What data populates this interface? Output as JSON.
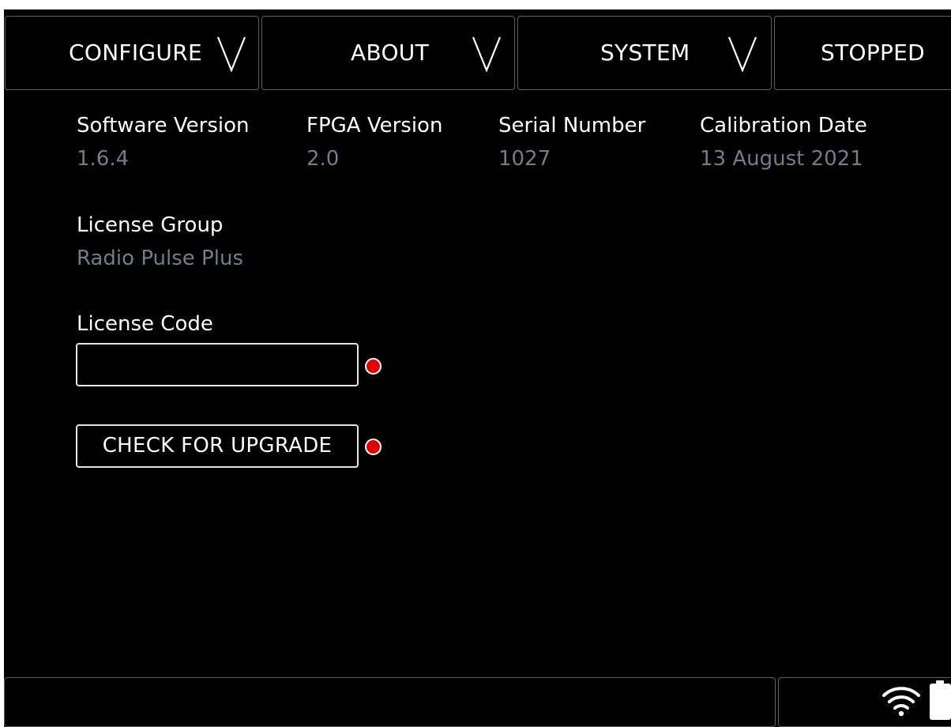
{
  "menu": {
    "tabs": [
      {
        "label": "CONFIGURE",
        "has_dropdown": true
      },
      {
        "label": "ABOUT",
        "has_dropdown": true
      },
      {
        "label": "SYSTEM",
        "has_dropdown": true
      },
      {
        "label": "STOPPED",
        "has_dropdown": false
      }
    ]
  },
  "about": {
    "software_version": {
      "label": "Software Version",
      "value": "1.6.4"
    },
    "fpga_version": {
      "label": "FPGA Version",
      "value": "2.0"
    },
    "serial_number": {
      "label": "Serial Number",
      "value": "1027"
    },
    "calibration_date": {
      "label": "Calibration Date",
      "value": "13 August 2021"
    },
    "license_group": {
      "label": "License Group",
      "value": "Radio Pulse Plus"
    },
    "license_code": {
      "label": "License Code",
      "value": "",
      "placeholder": ""
    },
    "check_upgrade_label": "CHECK FOR UPGRADE"
  },
  "status_bar": {
    "icons": [
      "wifi-icon",
      "battery-icon"
    ]
  },
  "colors": {
    "background": "#000000",
    "value_text": "#6f7d8c",
    "indicator": "#e00000",
    "border": "#5e5e5e"
  }
}
